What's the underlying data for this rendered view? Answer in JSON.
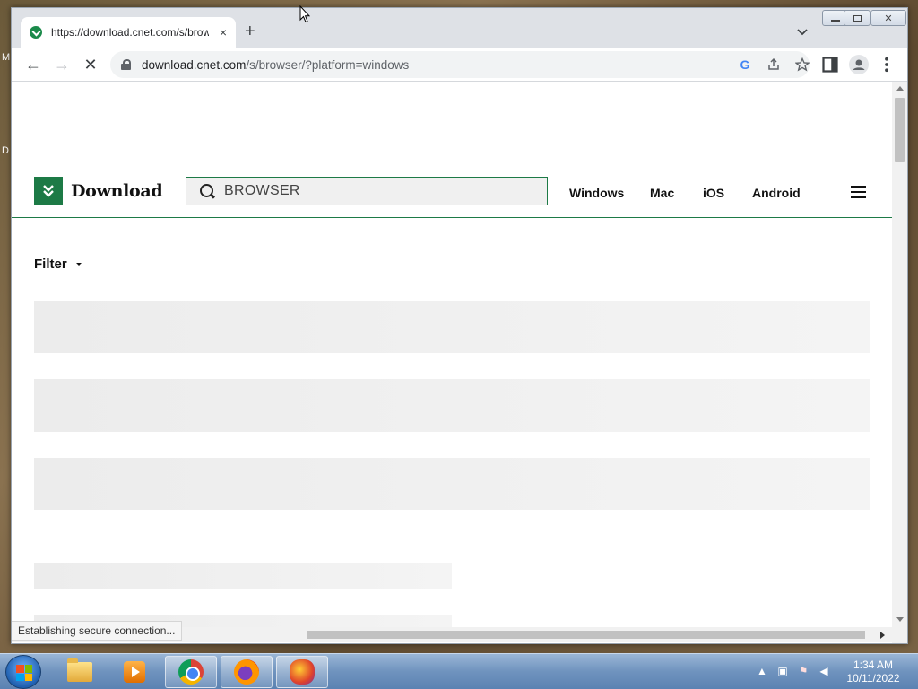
{
  "desktop": {
    "left_letters": [
      "M",
      "D"
    ]
  },
  "browser": {
    "tab": {
      "title": "https://download.cnet.com/s/browser/?platform=windows",
      "close": "×"
    },
    "new_tab": "+",
    "window_controls": {
      "minimize": "—",
      "restore": "❐",
      "close": "✕"
    },
    "nav": {
      "back": "←",
      "forward": "→",
      "stop": "✕"
    },
    "address": {
      "domain": "download.cnet.com",
      "path": "/s/browser/?platform=windows"
    },
    "omnibox_icons": [
      "google-lens-icon",
      "share-icon",
      "bookmark-star-icon"
    ],
    "toolbar_icons": [
      "side-panel-icon",
      "profile-icon",
      "menu-dots-icon"
    ],
    "status": "Establishing secure connection..."
  },
  "site": {
    "logo_text": "Download",
    "search_value": "BROWSER",
    "platforms": [
      "Windows",
      "Mac",
      "iOS",
      "Android"
    ],
    "filter_label": "Filter"
  },
  "taskbar": {
    "apps": [
      "windows-explorer",
      "media-player",
      "google-chrome",
      "firefox",
      "paint-app"
    ],
    "clock_time": "1:34 AM",
    "clock_date": "10/11/2022"
  }
}
